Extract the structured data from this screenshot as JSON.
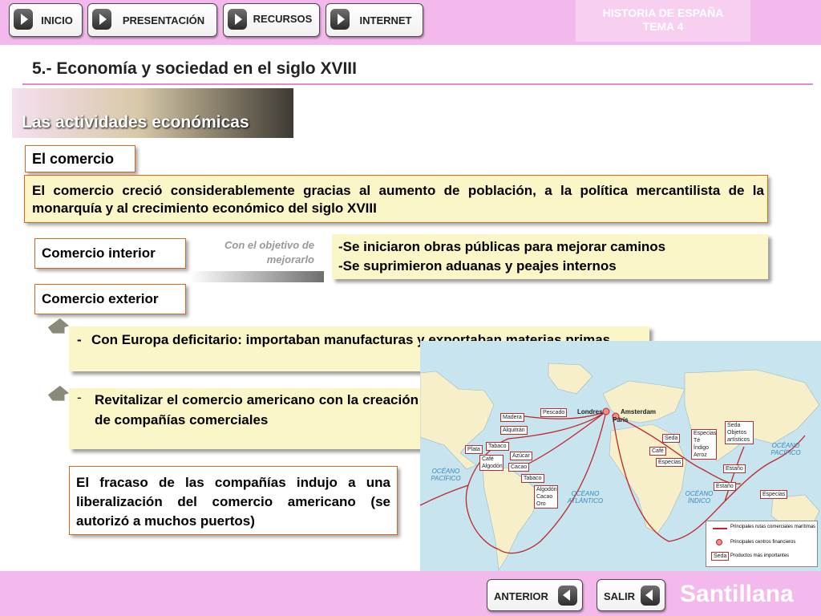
{
  "nav": {
    "inicio": "INICIO",
    "presentacion": "PRESENTACIÓN",
    "recursos": "RECURSOS",
    "internet": "INTERNET"
  },
  "course": {
    "line1": "HISTORIA DE ESPAÑA",
    "line2": "TEMA 4"
  },
  "title": "5.- Economía y sociedad en el siglo XVIII",
  "section": "Las actividades económicas",
  "comercio": {
    "label": "El comercio",
    "text": "El comercio creció considerablemente gracias al aumento de población, a la política mercantilista de la monarquía y al crecimiento económico del siglo XVIII"
  },
  "interior": {
    "label": "Comercio interior",
    "objetivo": "Con el objetivo de mejorarlo",
    "items": [
      "-Se iniciaron obras públicas para mejorar caminos",
      "-Se suprimieron aduanas y peajes internos"
    ]
  },
  "exterior": {
    "label": "Comercio exterior",
    "bullet1_dash": "-",
    "bullet1": "Con Europa deficitario: importaban manufacturas y exportaban materias primas",
    "bullet2_dash": "-",
    "bullet2": "Revitalizar el comercio americano con la creación de compañías comerciales"
  },
  "fracaso": "El fracaso de las compañías indujo a una liberalización del comercio americano (se autorizó a muchos puertos)",
  "map": {
    "products": {
      "madera": "Madera",
      "pescado": "Pescado",
      "alquitran": "Alquitrán",
      "plata": "Plata",
      "tabaco1": "Tabaco",
      "cafe_algodon": "Café Algodón",
      "azucar": "Azúcar",
      "cacao": "Cacao",
      "tabaco2": "Tabaco",
      "algodon_cacao_oro": "Algodón Cacao Oro",
      "seda1": "Seda",
      "cafe": "Café",
      "especias1": "Especias",
      "especias_te": "Especias Té Índigo Arroz",
      "seda_objetos": "Seda Objetos artísticos",
      "estano1": "Estaño",
      "estano2": "Estaño",
      "especias2": "Especias"
    },
    "cities": {
      "londres": "Londres",
      "amsterdam": "Amsterdam",
      "paris": "París"
    },
    "oceans": {
      "pacifico_w": "OCÉANO PACÍFICO",
      "atlantico": "OCÉANO ATLÁNTICO",
      "indico": "OCÉANO ÍNDICO",
      "pacifico_e": "OCÉANO PACÍFICO"
    },
    "legend": {
      "routes": "Principales rutas comerciales marítimas",
      "centers": "Principales centros financieros",
      "sample": "Seda",
      "products": "Productos más importantes"
    },
    "colors": {
      "route": "#c0252b",
      "land": "#f7efc9",
      "sea": "#c7e4ef"
    }
  },
  "bottom": {
    "anterior": "ANTERIOR",
    "salir": "SALIR",
    "brand": "Santillana"
  },
  "colors": {
    "bar": "#f3b9ec",
    "box_fill": "#fbf6c7",
    "box_border": "#d2691e"
  }
}
